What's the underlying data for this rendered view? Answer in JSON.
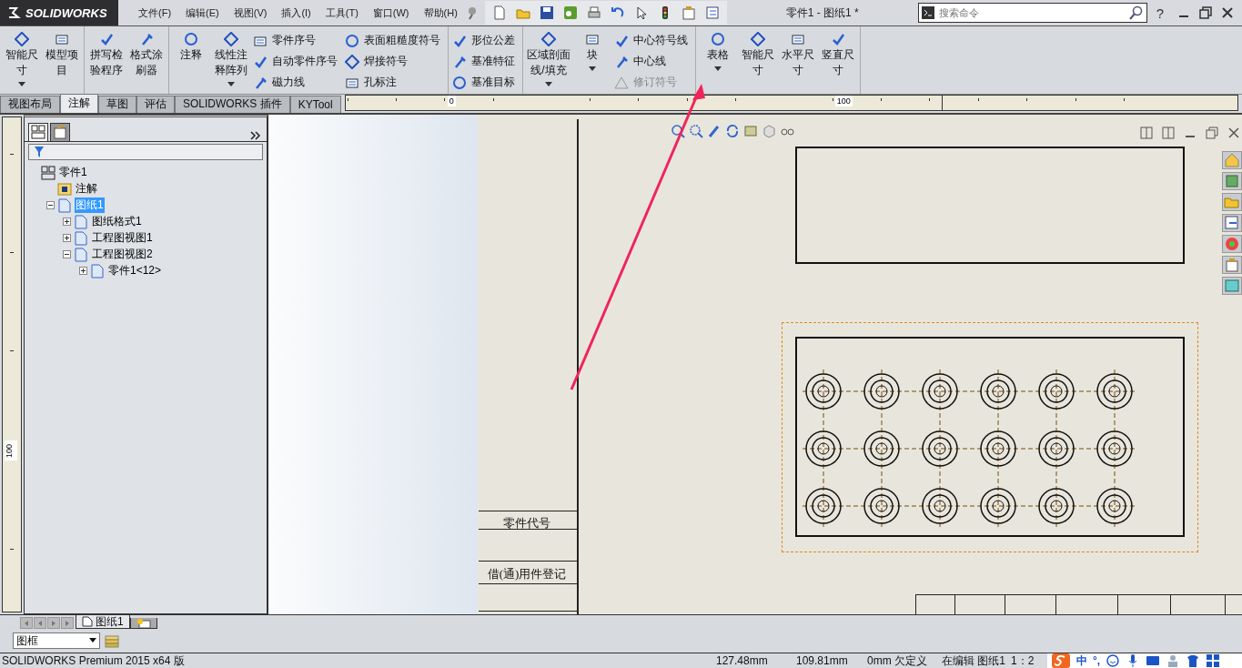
{
  "app": {
    "logo": "SOLIDWORKS",
    "title": "零件1 - 图纸1 *"
  },
  "menu": [
    {
      "label": "文件(F)"
    },
    {
      "label": "编辑(E)"
    },
    {
      "label": "视图(V)"
    },
    {
      "label": "插入(I)"
    },
    {
      "label": "工具(T)"
    },
    {
      "label": "窗口(W)"
    },
    {
      "label": "帮助(H)"
    }
  ],
  "search": {
    "placeholder": "搜索命令"
  },
  "help": {
    "label": "?"
  },
  "ribbon": [
    {
      "kind": "section",
      "entries": [
        {
          "kind": "large",
          "label": "智能尺寸",
          "dropdown": true
        },
        {
          "kind": "large",
          "label": "模型项目",
          "dropdown": false
        }
      ]
    },
    {
      "kind": "section",
      "entries": [
        {
          "kind": "large",
          "label": "拼写检验程序",
          "dropdown": false
        },
        {
          "kind": "large",
          "label": "格式涂刷器",
          "dropdown": false
        }
      ]
    },
    {
      "kind": "section",
      "entries": [
        {
          "kind": "large",
          "label": "注释",
          "dropdown": false
        },
        {
          "kind": "large",
          "label": "线性注释阵列",
          "dropdown": true
        },
        {
          "kind": "stack",
          "items": [
            {
              "label": "零件序号",
              "disabled": false
            },
            {
              "label": "自动零件序号",
              "disabled": false
            },
            {
              "label": "磁力线",
              "disabled": false
            }
          ]
        },
        {
          "kind": "stack",
          "items": [
            {
              "label": "表面粗糙度符号",
              "disabled": false
            },
            {
              "label": "焊接符号",
              "disabled": false
            },
            {
              "label": "孔标注",
              "disabled": false
            }
          ]
        }
      ]
    },
    {
      "kind": "section",
      "entries": [
        {
          "kind": "stack",
          "items": [
            {
              "label": "形位公差",
              "disabled": false
            },
            {
              "label": "基准特征",
              "disabled": false
            },
            {
              "label": "基准目标",
              "disabled": false
            }
          ]
        }
      ]
    },
    {
      "kind": "section",
      "entries": [
        {
          "kind": "large",
          "label": "区域剖面线/填充",
          "dropdown": true
        },
        {
          "kind": "large",
          "label": "块",
          "dropdown": true
        },
        {
          "kind": "stack",
          "items": [
            {
              "label": "中心符号线",
              "disabled": false
            },
            {
              "label": "中心线",
              "disabled": false
            },
            {
              "label": "修订符号",
              "disabled": true
            }
          ]
        }
      ]
    },
    {
      "kind": "section",
      "entries": [
        {
          "kind": "large",
          "label": "表格",
          "dropdown": true
        },
        {
          "kind": "large",
          "label": "智能尺寸",
          "dropdown": false
        },
        {
          "kind": "large",
          "label": "水平尺寸",
          "dropdown": false
        },
        {
          "kind": "large",
          "label": "竖直尺寸",
          "dropdown": false
        }
      ]
    }
  ],
  "tabs": [
    {
      "label": "视图布局",
      "selected": false
    },
    {
      "label": "注解",
      "selected": true
    },
    {
      "label": "草图",
      "selected": false
    },
    {
      "label": "评估",
      "selected": false
    },
    {
      "label": "SOLIDWORKS 插件",
      "selected": false
    },
    {
      "label": "KYTool",
      "selected": false
    }
  ],
  "ruler": {
    "marks": [
      "0",
      "100"
    ],
    "side_mark": "100"
  },
  "tree": [
    {
      "label": "零件1",
      "kind": "root",
      "selected": false,
      "children": [
        {
          "label": "注解",
          "kind": "leaf",
          "selected": false
        },
        {
          "label": "图纸1",
          "kind": "node",
          "expanded": true,
          "selected": true,
          "children": [
            {
              "label": "图纸格式1",
              "kind": "node",
              "expanded": false,
              "selected": false
            },
            {
              "label": "工程图视图1",
              "kind": "node",
              "expanded": false,
              "selected": false
            },
            {
              "label": "工程图视图2",
              "kind": "node",
              "expanded": true,
              "selected": false,
              "children": [
                {
                  "label": "零件1<12>",
                  "kind": "node",
                  "expanded": false,
                  "selected": false
                }
              ]
            }
          ]
        }
      ]
    }
  ],
  "sheet": {
    "title_block": [
      "零件代号",
      "借(通)用件登记"
    ]
  },
  "sheet_tabs": [
    {
      "label": "图纸1",
      "selected": true
    }
  ],
  "layer": {
    "value": "图框"
  },
  "status_bar": [
    {
      "text": "SOLIDWORKS Premium 2015 x64 版"
    },
    {
      "text": "127.48mm"
    },
    {
      "text": "109.81mm"
    },
    {
      "text": "0mm"
    },
    {
      "text": "欠定义"
    },
    {
      "text": "在编辑 图纸1"
    },
    {
      "text": "1：2"
    }
  ],
  "ime": [
    {
      "label": "中"
    },
    {
      "label": "°,"
    }
  ]
}
